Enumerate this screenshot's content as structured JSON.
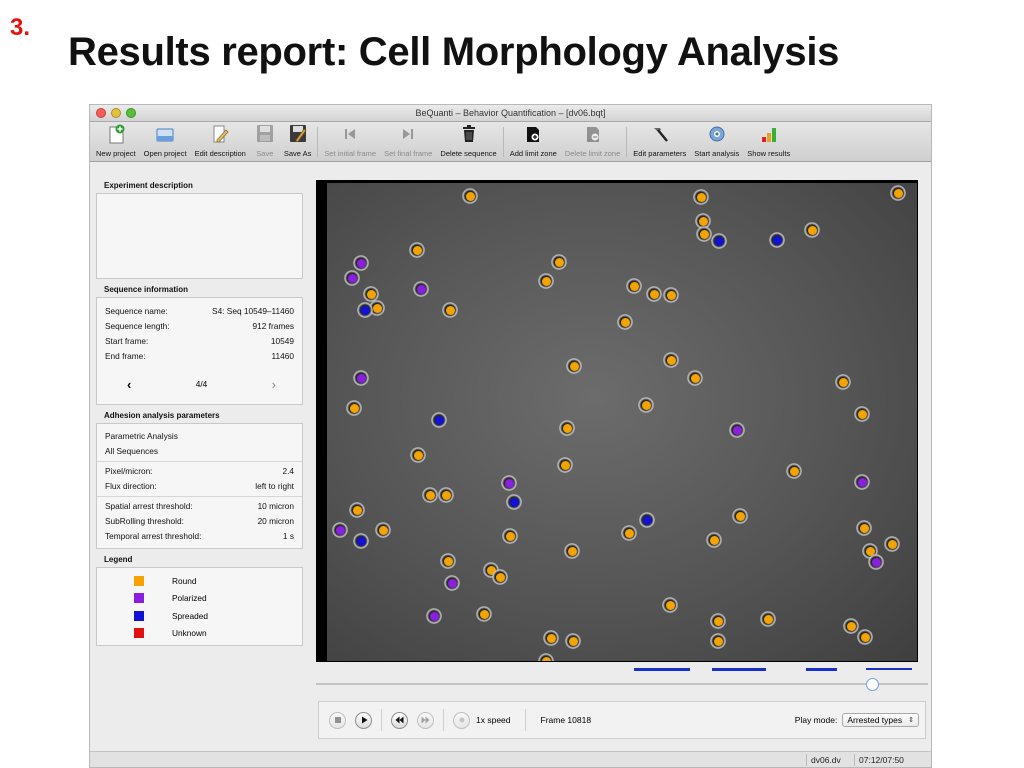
{
  "slide": {
    "number": "3.",
    "title": "Results report: Cell Morphology Analysis"
  },
  "window": {
    "title": "BeQuanti – Behavior Quantification – [dv06.bqt]"
  },
  "toolbar": {
    "new_project": "New project",
    "open_project": "Open project",
    "edit_description": "Edit description",
    "save": "Save",
    "save_as": "Save As",
    "set_initial_frame": "Set initial frame",
    "set_final_frame": "Set final frame",
    "delete_sequence": "Delete sequence",
    "add_limit_zone": "Add limit zone",
    "delete_limit_zone": "Delete limit zone",
    "edit_parameters": "Edit parameters",
    "start_analysis": "Start analysis",
    "show_results": "Show results"
  },
  "experiment": {
    "title": "Experiment description",
    "text": ""
  },
  "sequence": {
    "title": "Sequence information",
    "name_label": "Sequence name:",
    "name_value": "S4: Seq 10549–11460",
    "length_label": "Sequence length:",
    "length_value": "912 frames",
    "start_label": "Start frame:",
    "start_value": "10549",
    "end_label": "End frame:",
    "end_value": "11460",
    "prev": "‹",
    "page": "4/4",
    "next": "›"
  },
  "adhesion": {
    "title": "Adhesion analysis parameters",
    "mode": "Parametric Analysis",
    "scope": "All Sequences",
    "pixel_label": "Pixel/micron:",
    "pixel_value": "2.4",
    "flux_label": "Flux direction:",
    "flux_value": "left to right",
    "spatial_label": "Spatial arrest threshold:",
    "spatial_value": "10 micron",
    "subrolling_label": "SubRolling threshold:",
    "subrolling_value": "20 micron",
    "temporal_label": "Temporal arrest threshold:",
    "temporal_value": "1 s"
  },
  "legend": {
    "title": "Legend",
    "items": [
      {
        "label": "Round",
        "color": "#f5a300"
      },
      {
        "label": "Polarized",
        "color": "#8b1fe0"
      },
      {
        "label": "Spreaded",
        "color": "#1212d6"
      },
      {
        "label": "Unknown",
        "color": "#e01010"
      }
    ]
  },
  "playback": {
    "speed": "1x speed",
    "frame": "Frame 10818",
    "play_mode_label": "Play mode:",
    "play_mode_value": "Arrested types"
  },
  "status": {
    "file": "dv06.dv",
    "time": "07:12/07:50"
  },
  "colors": {
    "round": "#f5a300",
    "polarized": "#8b1fe0",
    "spreaded": "#1212d6",
    "track": "#1630c8",
    "slide_number": "#e8120f"
  }
}
